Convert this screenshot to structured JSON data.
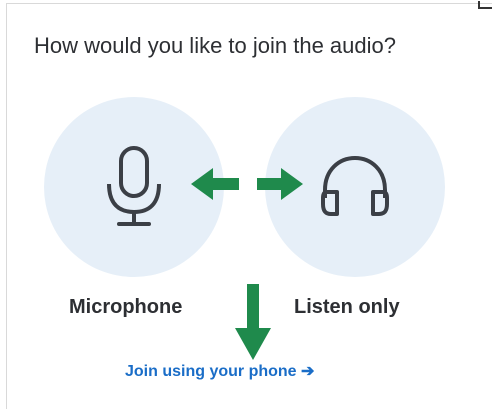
{
  "dialog": {
    "title": "How would you like to join the audio?"
  },
  "options": {
    "microphone": {
      "label": "Microphone",
      "icon": "microphone-icon"
    },
    "listen_only": {
      "label": "Listen only",
      "icon": "headphones-icon"
    }
  },
  "phone_link": {
    "label": "Join using your phone ➔"
  },
  "colors": {
    "title_text": "#2d2f33",
    "option_circle": "#e6eff8",
    "icon_stroke": "#3b3f46",
    "link": "#1a6dc7",
    "annotation_arrow": "#1f8a4c"
  },
  "annotations": {
    "arrows": [
      "double-arrow-between-options",
      "down-arrow-to-phone-link"
    ]
  }
}
